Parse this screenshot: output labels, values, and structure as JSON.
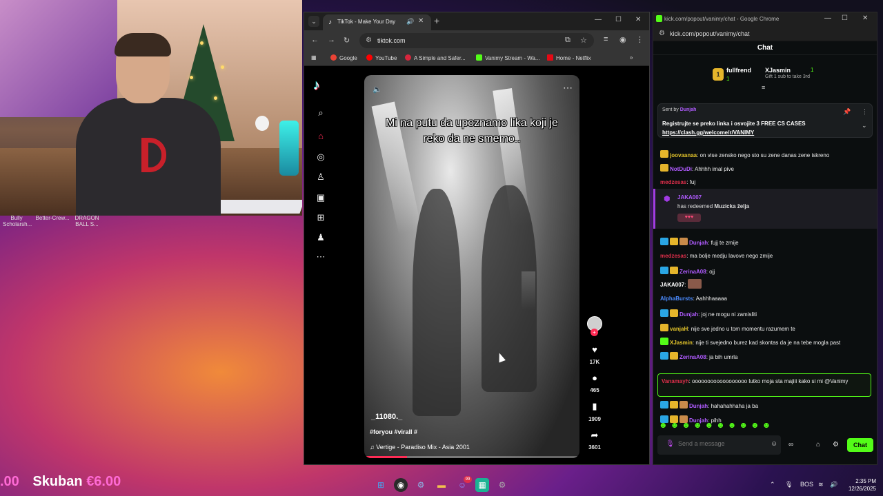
{
  "webcam": {
    "game_labels": [
      "Bully Scholarsh...",
      "Better-Crew...",
      "DRAGON BALL S..."
    ]
  },
  "browser": {
    "tab": {
      "title": "TikTok - Make Your Day"
    },
    "url": "tiktok.com",
    "bookmarks": [
      {
        "label": "Google",
        "color": "#ea4335"
      },
      {
        "label": "YouTube",
        "color": "#ff0000"
      },
      {
        "label": "A Simple and Safer...",
        "color": "#d7263d"
      },
      {
        "label": "Vanimy Stream - Wa...",
        "color": "#53fc18"
      },
      {
        "label": "Home - Netflix",
        "color": "#e50914"
      }
    ]
  },
  "tiktok": {
    "caption": "Mi na putu da upoznamo lika koji je reko da ne smemo..",
    "author": "_11080._",
    "tags": "#foryou #virall #",
    "music": "Vertige - Paradiso Mix - Asia 2001",
    "progress": 0.2,
    "counts": {
      "likes": "17K",
      "comments": "465",
      "saves": "1909",
      "shares": "3601"
    }
  },
  "chat": {
    "window_title": "kick.com/popout/vanimy/chat - Google Chrome",
    "url": "kick.com/popout/vanimy/chat",
    "header": "Chat",
    "gifters": [
      {
        "name": "fullfrend",
        "count": "1"
      },
      {
        "name": "XJasmin",
        "count": "1"
      }
    ],
    "gift_prompt": "Gift 1 sub to take 3rd",
    "pinned": {
      "sent_by_label": "Sent by",
      "sender": "Dunjah",
      "text": "Registrujte se preko linka i osvojite 3 FREE CS CASES",
      "link": "https://clash.gg/welcome/r/VANIMY"
    },
    "messages": [
      {
        "user": "joovaanaa",
        "color": "#e5c62b",
        "text": "on vise zensko nego sto su zene danas zene iskreno"
      },
      {
        "user": "NotDuDi",
        "color": "#b05bff",
        "text": "Ahhhh imal pive"
      },
      {
        "user": "medzesas",
        "color": "#e02f4b",
        "text": "fuj"
      },
      {
        "user": "Dunjah",
        "color": "#b05bff",
        "text": "fujj te zmije"
      },
      {
        "user": "medzesas",
        "color": "#e02f4b",
        "text": "ma bolje medju lavove nego zmije"
      },
      {
        "user": "ZerinaA08",
        "color": "#b05bff",
        "text": "ojj"
      },
      {
        "user": "JAKA007",
        "color": "#ffffff",
        "text": ""
      },
      {
        "user": "AlphaBursts",
        "color": "#4b8bff",
        "text": "Aahhhaaaaa"
      },
      {
        "user": "Dunjah",
        "color": "#b05bff",
        "text": "joj ne mogu ni zamisliti"
      },
      {
        "user": "vanjaH",
        "color": "#e5c62b",
        "text": "nije sve jedno u tom momentu razumem te"
      },
      {
        "user": "XJasmin",
        "color": "#e5c62b",
        "text": "nije ti svejedno burez kad skontas da je na tebe mogla past"
      },
      {
        "user": "ZerinaA08",
        "color": "#b05bff",
        "text": "ja bih umrla"
      },
      {
        "user": "Dunjah",
        "color": "#b05bff",
        "text": "hahahahhaha ja ba"
      },
      {
        "user": "Dunjah",
        "color": "#b05bff",
        "text": "pihh"
      }
    ],
    "redeem": {
      "user": "JAKA007",
      "action": "has redeemed",
      "reward": "Muzicka želja"
    },
    "highlight": {
      "user": "Vanamayh",
      "text": "oooooooooooooooooo lutko moja sta majiii kako si mi @Vanimy"
    },
    "input_placeholder": "Send a message",
    "send_label": "Chat"
  },
  "donation": {
    "name": "Skuban",
    "amount": "€6.00",
    "prev_amount": ".00"
  },
  "taskbar": {
    "lang": "BOS",
    "time": "2:35 PM",
    "date": "12/26/2025",
    "notif_count": "99"
  },
  "colors": {
    "kick_green": "#53fc18",
    "tiktok_red": "#fe2c55"
  }
}
